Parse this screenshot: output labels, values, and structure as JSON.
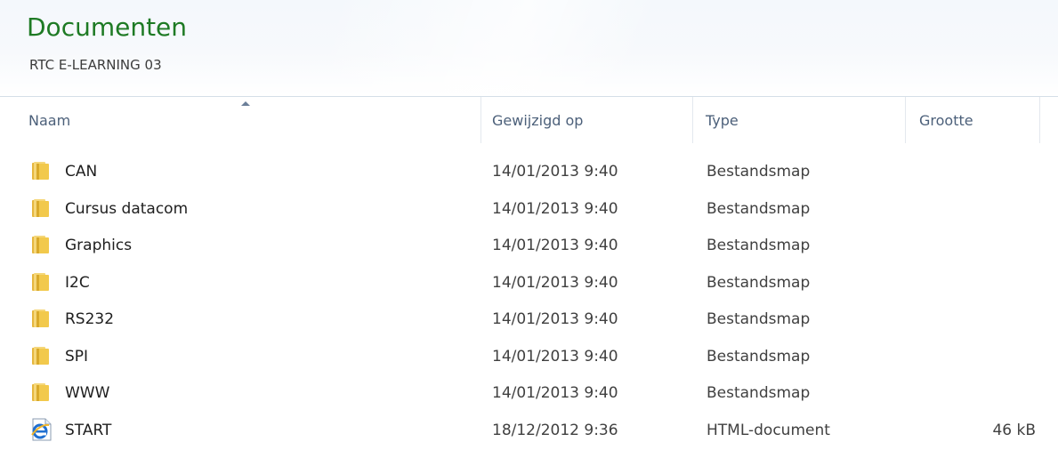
{
  "library": {
    "title": "Documenten",
    "subtitle": "RTC E-LEARNING 03"
  },
  "columns": {
    "name": "Naam",
    "modified": "Gewijzigd op",
    "type": "Type",
    "size": "Grootte",
    "sort_column": "name",
    "sort_direction": "ascending"
  },
  "files": [
    {
      "name": "CAN",
      "modified": "14/01/2013 9:40",
      "type": "Bestandsmap",
      "size": "",
      "icon": "folder-icon"
    },
    {
      "name": "Cursus datacom",
      "modified": "14/01/2013 9:40",
      "type": "Bestandsmap",
      "size": "",
      "icon": "folder-icon"
    },
    {
      "name": "Graphics",
      "modified": "14/01/2013 9:40",
      "type": "Bestandsmap",
      "size": "",
      "icon": "folder-icon"
    },
    {
      "name": "I2C",
      "modified": "14/01/2013 9:40",
      "type": "Bestandsmap",
      "size": "",
      "icon": "folder-icon"
    },
    {
      "name": "RS232",
      "modified": "14/01/2013 9:40",
      "type": "Bestandsmap",
      "size": "",
      "icon": "folder-icon"
    },
    {
      "name": "SPI",
      "modified": "14/01/2013 9:40",
      "type": "Bestandsmap",
      "size": "",
      "icon": "folder-icon"
    },
    {
      "name": "WWW",
      "modified": "14/01/2013 9:40",
      "type": "Bestandsmap",
      "size": "",
      "icon": "folder-icon"
    },
    {
      "name": "START",
      "modified": "18/12/2012 9:36",
      "type": "HTML-document",
      "size": "46 kB",
      "icon": "ie-html-icon"
    }
  ],
  "colors": {
    "title_green": "#1e7a24",
    "header_text": "#4c607a",
    "folder_yellow": "#f2c94c",
    "ie_blue": "#1f6fd1"
  }
}
